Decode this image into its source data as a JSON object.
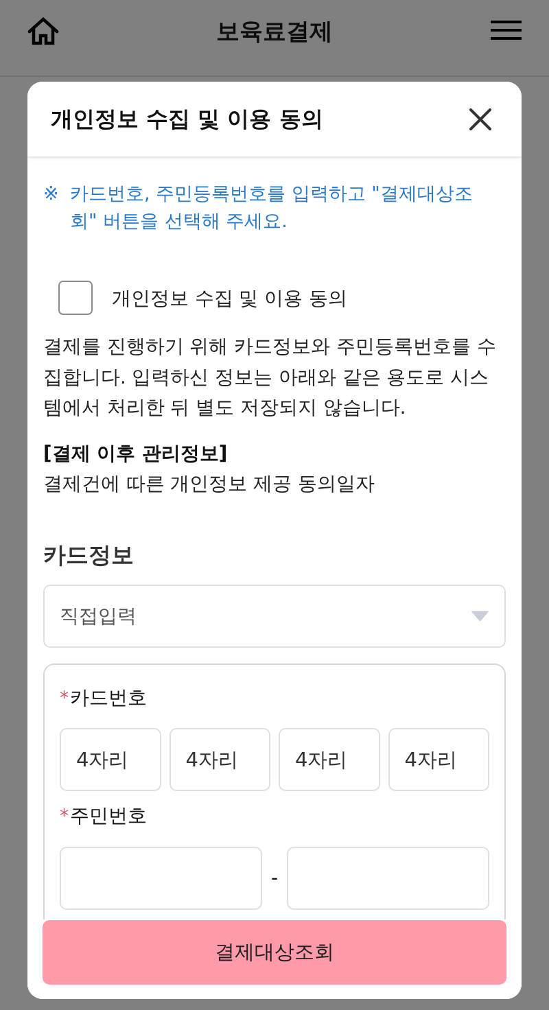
{
  "header": {
    "title": "보육료결제"
  },
  "dialog": {
    "title": "개인정보 수집 및 이용 동의",
    "notice": {
      "mark": "※",
      "text": "카드번호, 주민등록번호를 입력하고 \"결제대상조회\" 버튼을 선택해 주세요."
    },
    "consent": {
      "label": "개인정보 수집 및 이용 동의",
      "checked": false
    },
    "description": "결제를 진행하기 위해 카드정보와 주민등록번호를 수집합니다. 입력하신 정보는 아래와 같은 용도로 시스템에서 처리한 뒤 별도 저장되지 않습니다.",
    "managed_info": {
      "heading": "[결제 이후 관리정보]",
      "text": "결제건에 따른 개인정보 제공 동의일자"
    },
    "card_section": {
      "title": "카드정보",
      "select": {
        "value": "직접입력"
      },
      "fields": [
        {
          "kind": "card",
          "mark": "*",
          "label": "카드번호",
          "inputs": [
            {
              "placeholder": "4자리"
            },
            {
              "placeholder": "4자리"
            },
            {
              "placeholder": "4자리"
            },
            {
              "placeholder": "4자리"
            }
          ]
        },
        {
          "kind": "resident",
          "mark": "*",
          "label": "주민번호",
          "separator": "-"
        }
      ]
    },
    "button": {
      "label": "결제대상조회"
    }
  }
}
